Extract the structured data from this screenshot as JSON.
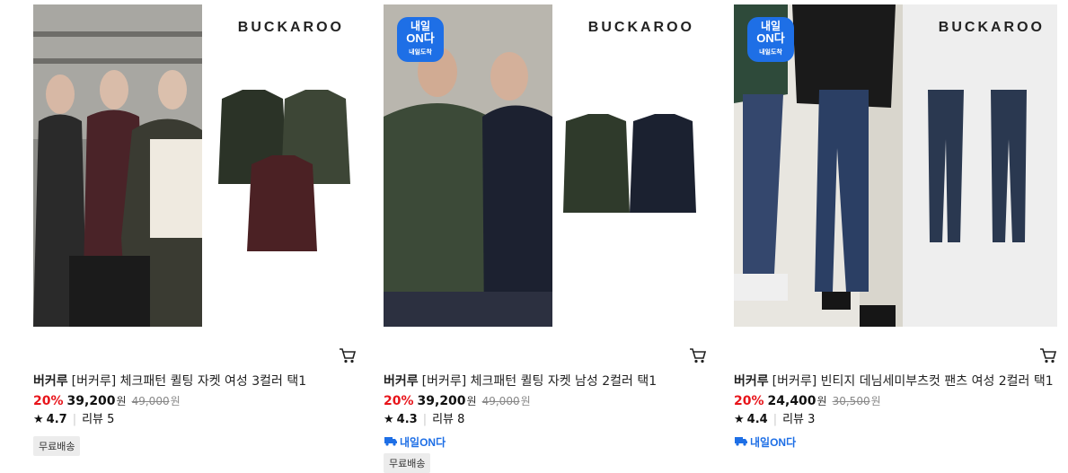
{
  "colors": {
    "discount": "#e8141a",
    "onda_blue": "#1e6fe6"
  },
  "products": [
    {
      "image_brand": "BUCKAROO",
      "has_badge": false,
      "brand": "버커루",
      "title": "[버커루] 체크패턴 퀼팅 자켓 여성 3컬러 택1",
      "discount": "20%",
      "price": "39,200",
      "won": "원",
      "original_price": "49,000",
      "original_won": "원",
      "rating": "4.7",
      "review_label": "리뷰 5",
      "shipping_tag": "무료배송",
      "onda_label": ""
    },
    {
      "image_brand": "BUCKAROO",
      "has_badge": true,
      "badge": {
        "line1": "내일",
        "line2": "ON다",
        "line3": "내일도착"
      },
      "brand": "버커루",
      "title": "[버커루] 체크패턴 퀼팅 자켓 남성 2컬러 택1",
      "discount": "20%",
      "price": "39,200",
      "won": "원",
      "original_price": "49,000",
      "original_won": "원",
      "rating": "4.3",
      "review_label": "리뷰 8",
      "onda_label": "내일ON다",
      "shipping_tag": "무료배송"
    },
    {
      "image_brand": "BUCKAROO",
      "has_badge": true,
      "badge": {
        "line1": "내일",
        "line2": "ON다",
        "line3": "내일도착"
      },
      "brand": "버커루",
      "title": "[버커루] 빈티지 데님세미부츠컷 팬츠 여성 2컬러 택1",
      "discount": "20%",
      "price": "24,400",
      "won": "원",
      "original_price": "30,500",
      "original_won": "원",
      "rating": "4.4",
      "review_label": "리뷰 3",
      "onda_label": "내일ON다",
      "shipping_tag": ""
    }
  ]
}
